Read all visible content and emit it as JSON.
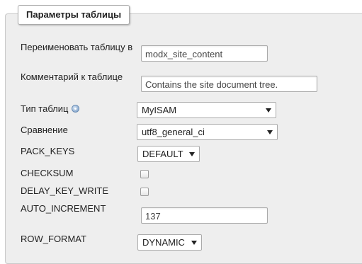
{
  "fieldset": {
    "legend": "Параметры таблицы"
  },
  "rows": {
    "rename": {
      "label": "Переименовать таблицу в",
      "value": "modx_site_content"
    },
    "comment": {
      "label": "Комментарий к таблице",
      "value": "Contains the site document tree."
    },
    "engine": {
      "label": "Тип таблиц",
      "hint_icon": "help-icon",
      "selected": "MyISAM"
    },
    "collation": {
      "label": "Сравнение",
      "selected": "utf8_general_ci"
    },
    "pack_keys": {
      "label": "PACK_KEYS",
      "selected": "DEFAULT"
    },
    "checksum": {
      "label": "CHECKSUM",
      "checked": false
    },
    "delay_key_write": {
      "label": "DELAY_KEY_WRITE",
      "checked": false
    },
    "auto_increment": {
      "label": "AUTO_INCREMENT",
      "value": "137"
    },
    "row_format": {
      "label": "ROW_FORMAT",
      "selected": "DYNAMIC"
    }
  }
}
